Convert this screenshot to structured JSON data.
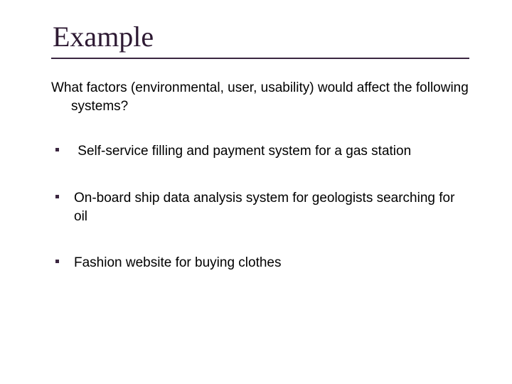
{
  "slide": {
    "title": "Example",
    "question": "What factors (environmental, user, usability) would affect the following systems?",
    "bullets": [
      "Self-service filling and payment system for a gas station",
      "On-board ship data analysis system for geologists searching for oil",
      "Fashion website for buying clothes"
    ]
  }
}
